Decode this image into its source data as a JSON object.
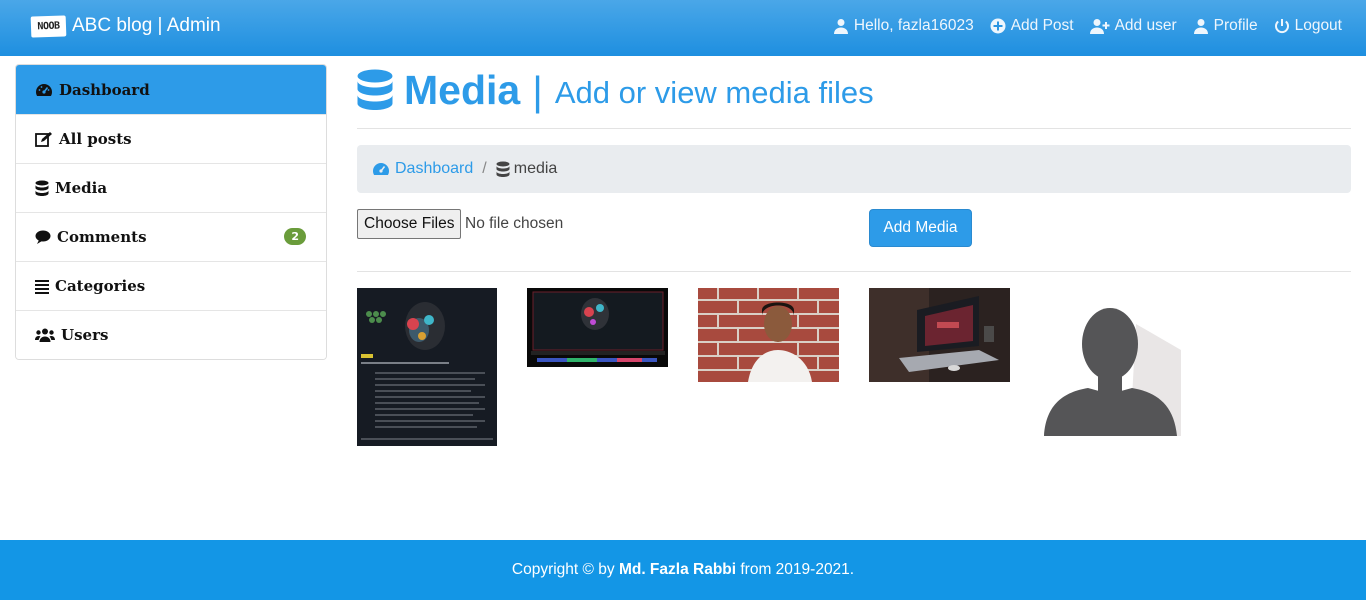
{
  "navbar": {
    "logo_text": "NOOB",
    "brand": "ABC blog | Admin",
    "greeting": "Hello, fazla16023",
    "add_post": "Add Post",
    "add_user": "Add user",
    "profile": "Profile",
    "logout": "Logout"
  },
  "sidebar": {
    "items": [
      {
        "label": "Dashboard",
        "icon": "tachometer-icon",
        "active": true
      },
      {
        "label": "All posts",
        "icon": "edit-icon"
      },
      {
        "label": "Media",
        "icon": "database-icon"
      },
      {
        "label": "Comments",
        "icon": "comment-icon",
        "badge": "2"
      },
      {
        "label": "Categories",
        "icon": "list-icon"
      },
      {
        "label": "Users",
        "icon": "users-icon"
      }
    ]
  },
  "header": {
    "title": "Media",
    "separator": "|",
    "subtitle": "Add or view media files"
  },
  "breadcrumb": {
    "home": "Dashboard",
    "separator": "/",
    "current": "media"
  },
  "upload": {
    "choose_label": "Choose Files",
    "status": "No file chosen",
    "submit_label": "Add Media"
  },
  "media_items": [
    {
      "name": "screenshot-dark-app"
    },
    {
      "name": "astronaut-monitor"
    },
    {
      "name": "person-brick-wall"
    },
    {
      "name": "laptop-desk"
    },
    {
      "name": "default-avatar"
    }
  ],
  "footer": {
    "prefix": "Copyright © by ",
    "author": "Md. Fazla Rabbi",
    "suffix": " from 2019-2021."
  },
  "colors": {
    "primary": "#2d9be8",
    "navbar_top": "#4aa7e8",
    "footer": "#1396e6",
    "badge": "#6a9c3b"
  }
}
